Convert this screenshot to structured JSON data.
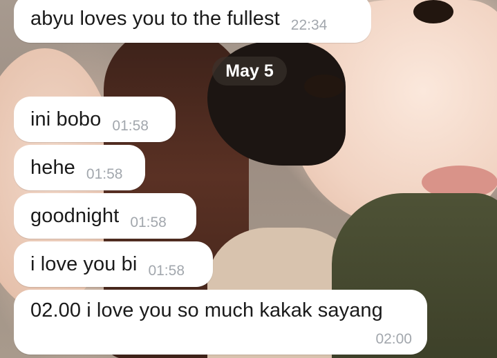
{
  "chat": {
    "messages": [
      {
        "text": "abyu loves you to the fullest",
        "time": "22:34"
      },
      {
        "text": "ini bobo",
        "time": "01:58"
      },
      {
        "text": "hehe",
        "time": "01:58"
      },
      {
        "text": "goodnight",
        "time": "01:58"
      },
      {
        "text": "i love you bi",
        "time": "01:58"
      },
      {
        "text": "02.00 i love you so much kakak sayang",
        "time": "02:00"
      }
    ],
    "date_separator": "May 5",
    "bubble_color": "#ffffff",
    "time_color": "#a2a7ad"
  }
}
